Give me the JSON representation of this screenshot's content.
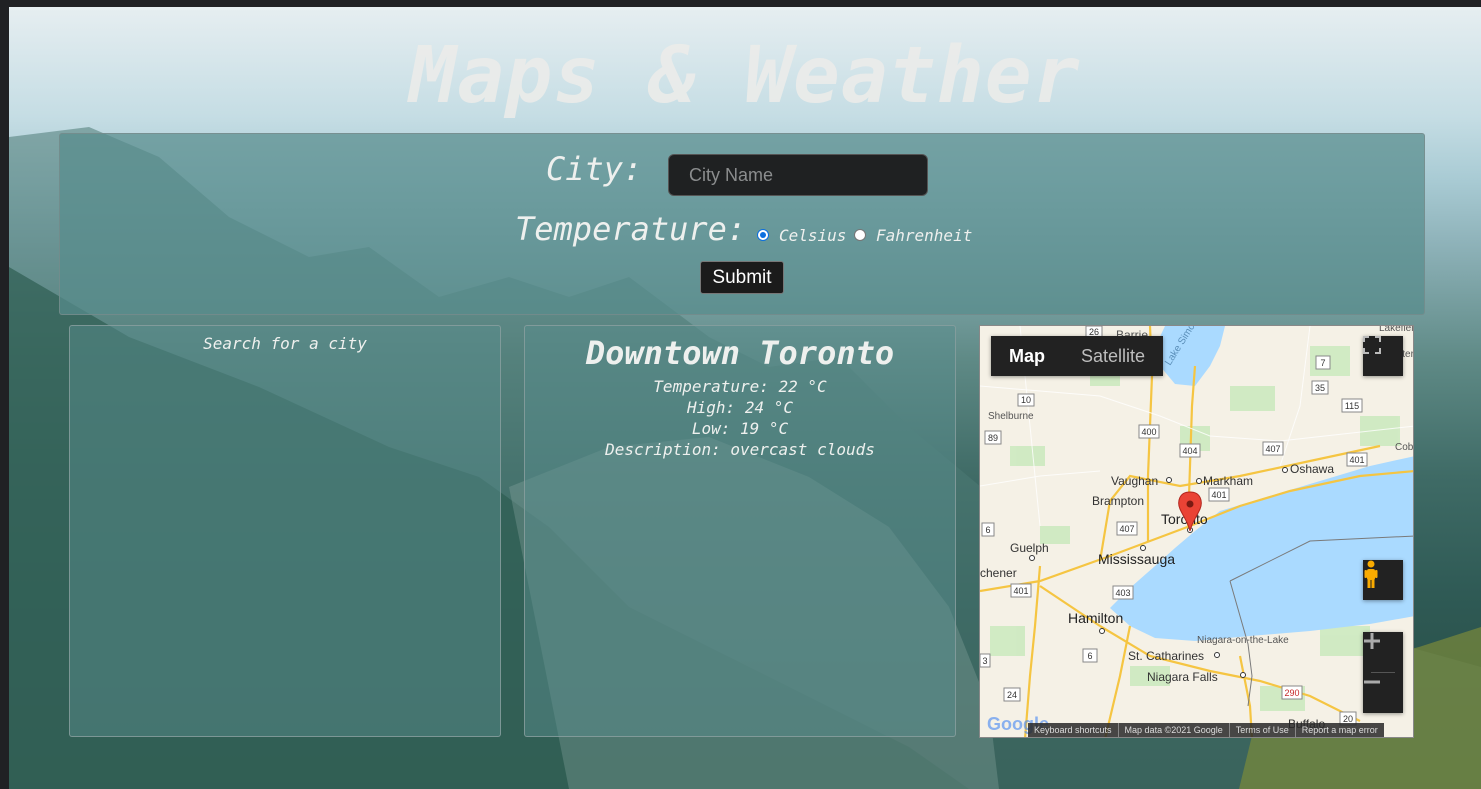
{
  "page": {
    "title": "Maps & Weather"
  },
  "form": {
    "city_label": "City:",
    "city_placeholder": "City Name",
    "city_value": "",
    "temperature_label": "Temperature:",
    "unit_options": [
      {
        "label": "Celsius",
        "checked": true
      },
      {
        "label": "Fahrenheit",
        "checked": false
      }
    ],
    "submit_label": "Submit"
  },
  "search_panel": {
    "text": "Search for a city"
  },
  "weather": {
    "city": "Downtown Toronto",
    "temperature": "Temperature: 22 °C",
    "high": "High: 24 °C",
    "low": "Low: 19 °C",
    "description": "Description: overcast clouds"
  },
  "map": {
    "tabs": [
      {
        "label": "Map",
        "active": true
      },
      {
        "label": "Satellite",
        "active": false
      }
    ],
    "fullscreen_icon": "fullscreen-icon",
    "pegman_icon": "pegman-icon",
    "zoom_in_icon": "plus-icon",
    "zoom_out_icon": "minus-icon",
    "logo": "Google",
    "places": {
      "barrie": "Barrie",
      "lake_simcoe": "Lake Simcoe",
      "lakefield": "Lakefield",
      "shelburne": "Shelburne",
      "vaughan": "Vaughan",
      "markham": "Markham",
      "oshawa": "Oshawa",
      "brampton": "Brampton",
      "toronto": "Toronto",
      "guelph": "Guelph",
      "kitchener": "chener",
      "mississauga": "Mississauga",
      "hamilton": "Hamilton",
      "niagara_lake": "Niagara-on-the-Lake",
      "st_catharines": "St. Catharines",
      "niagara_falls": "Niagara Falls",
      "buffalo": "Buffalo",
      "peterborough": "Peterboroug",
      "cobourg": "Cobo"
    },
    "route_labels": {
      "r26": "26",
      "r7": "7",
      "r35": "35",
      "r115": "115",
      "r10": "10",
      "r89": "89",
      "r400": "400",
      "r404": "404",
      "r407": "407",
      "r401": "401",
      "r6": "6",
      "r403": "403",
      "r24": "24",
      "r290": "290",
      "r3": "3",
      "r20": "20"
    },
    "attribution": {
      "shortcuts": "Keyboard shortcuts",
      "data": "Map data ©2021 Google",
      "terms": "Terms of Use",
      "report": "Report a map error"
    }
  },
  "colors": {
    "panel": "#578c8c",
    "title": "#ecece9",
    "radio_checked": "#0b6fe0",
    "marker": "#ea4335",
    "lake": "#aadaff",
    "land": "#f7f3e8"
  }
}
